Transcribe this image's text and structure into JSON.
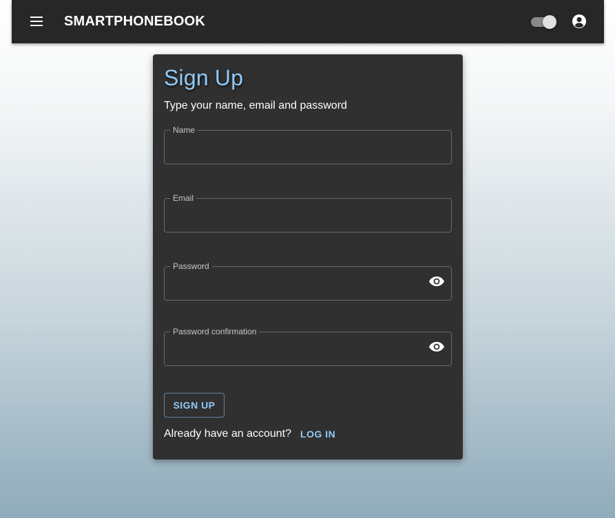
{
  "appbar": {
    "title": "SMARTPHONEBOOK",
    "menu_icon": "menu-icon",
    "theme_toggle_icon": "toggle-switch-icon",
    "account_icon": "account-circle-icon"
  },
  "form": {
    "title": "Sign Up",
    "subtitle": "Type your name, email and password",
    "fields": [
      {
        "label": "Name",
        "value": ""
      },
      {
        "label": "Email",
        "value": ""
      },
      {
        "label": "Password",
        "value": "",
        "icon": "eye-icon"
      },
      {
        "label": "Password confirmation",
        "value": "",
        "icon": "eye-icon"
      }
    ],
    "submit_label": "SIGN UP",
    "footer_text": "Already have an account?",
    "login_label": "LOG IN"
  },
  "colors": {
    "appbar_bg": "#272727",
    "card_bg": "#303030",
    "accent": "#90caf9",
    "text": "#ffffff"
  }
}
